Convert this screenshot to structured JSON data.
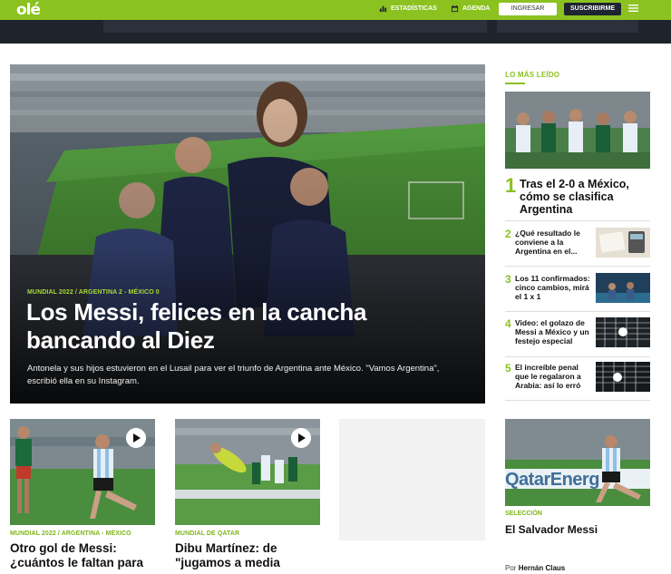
{
  "header": {
    "logo": "olé",
    "nav_stats": "ESTADÍSTICAS",
    "nav_agenda": "AGENDA",
    "login_label": "INGRESAR",
    "subscribe_label": "SUSCRIBIRME"
  },
  "hero": {
    "tag": "MUNDIAL 2022 / ARGENTINA 2 - MÉXICO 0",
    "title": "Los Messi, felices en la cancha bancando al Diez",
    "subtitle": "Antonela y sus hijos estuvieron en el Lusail para ver el triunfo de Argentina ante México. \"Vamos Argentina\", escribió ella en su Instagram."
  },
  "cards": [
    {
      "tag": "MUNDIAL 2022 / ARGENTINA - MÉXICO",
      "title": "Otro gol de Messi: ¿cuántos le faltan para"
    },
    {
      "tag": "MUNDIAL DE QATAR",
      "title": "Dibu Martínez: de \"jugamos a media"
    }
  ],
  "sidebar": {
    "heading": "LO MÁS LEÍDO",
    "top": {
      "rank": "1",
      "title": "Tras el 2-0 a México, cómo se clasifica Argentina"
    },
    "items": [
      {
        "rank": "2",
        "title": "¿Qué resultado le conviene a la Argentina en el..."
      },
      {
        "rank": "3",
        "title": "Los 11 confirmados: cinco cambios, mirá el 1 x 1"
      },
      {
        "rank": "4",
        "title": "Video: el golazo de Messi a México y un festejo especial"
      },
      {
        "rank": "5",
        "title": "El increíble penal que le regalaron a Arabia: así lo erró"
      }
    ],
    "feature": {
      "tag": "SELECCIÓN",
      "title": "El Salvador Messi",
      "author_prefix": "Por",
      "author": "Hernán Claus",
      "banner_text": "QatarEnerg"
    }
  },
  "colors": {
    "brand_green": "#8bc220",
    "dark_band": "#1f232c",
    "tag_green": "#a6d936"
  }
}
